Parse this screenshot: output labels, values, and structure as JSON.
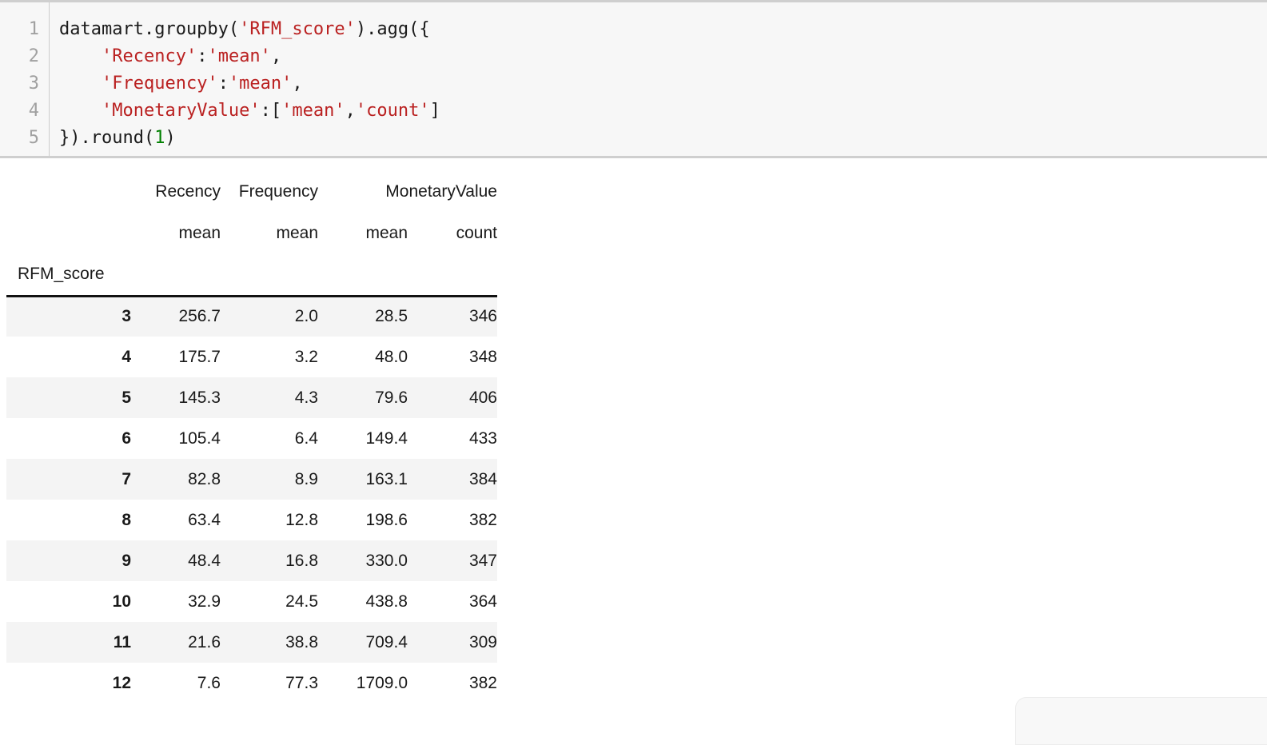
{
  "code_cell": {
    "line_numbers": [
      "1",
      "2",
      "3",
      "4",
      "5"
    ],
    "lines": [
      [
        {
          "t": "plain",
          "s": "datamart.groupby("
        },
        {
          "t": "str",
          "s": "'RFM_score'"
        },
        {
          "t": "plain",
          "s": ").agg({"
        }
      ],
      [
        {
          "t": "plain",
          "s": "    "
        },
        {
          "t": "str",
          "s": "'Recency'"
        },
        {
          "t": "plain",
          "s": ":"
        },
        {
          "t": "str",
          "s": "'mean'"
        },
        {
          "t": "plain",
          "s": ","
        }
      ],
      [
        {
          "t": "plain",
          "s": "    "
        },
        {
          "t": "str",
          "s": "'Frequency'"
        },
        {
          "t": "plain",
          "s": ":"
        },
        {
          "t": "str",
          "s": "'mean'"
        },
        {
          "t": "plain",
          "s": ","
        }
      ],
      [
        {
          "t": "plain",
          "s": "    "
        },
        {
          "t": "str",
          "s": "'MonetaryValue'"
        },
        {
          "t": "plain",
          "s": ":["
        },
        {
          "t": "str",
          "s": "'mean'"
        },
        {
          "t": "plain",
          "s": ","
        },
        {
          "t": "str",
          "s": "'count'"
        },
        {
          "t": "plain",
          "s": "]"
        }
      ],
      [
        {
          "t": "plain",
          "s": "}).round("
        },
        {
          "t": "num",
          "s": "1"
        },
        {
          "t": "plain",
          "s": ")"
        }
      ]
    ],
    "colors": {
      "string": "#ba2121",
      "number": "#008000",
      "plain": "#1a1a1a",
      "line_number": "#a0a0a0",
      "background": "#f7f7f7"
    }
  },
  "dataframe": {
    "index_name": "RFM_score",
    "top_headers": [
      "Recency",
      "Frequency",
      "MonetaryValue"
    ],
    "sub_headers": [
      "mean",
      "mean",
      "mean",
      "count"
    ],
    "columns": [
      {
        "top": "Recency",
        "sub": "mean"
      },
      {
        "top": "Frequency",
        "sub": "mean"
      },
      {
        "top": "MonetaryValue",
        "sub": "mean"
      },
      {
        "top": "MonetaryValue",
        "sub": "count"
      }
    ],
    "rows": [
      {
        "index": "3",
        "recency_mean": "256.7",
        "frequency_mean": "2.0",
        "monetary_mean": "28.5",
        "monetary_count": "346"
      },
      {
        "index": "4",
        "recency_mean": "175.7",
        "frequency_mean": "3.2",
        "monetary_mean": "48.0",
        "monetary_count": "348"
      },
      {
        "index": "5",
        "recency_mean": "145.3",
        "frequency_mean": "4.3",
        "monetary_mean": "79.6",
        "monetary_count": "406"
      },
      {
        "index": "6",
        "recency_mean": "105.4",
        "frequency_mean": "6.4",
        "monetary_mean": "149.4",
        "monetary_count": "433"
      },
      {
        "index": "7",
        "recency_mean": "82.8",
        "frequency_mean": "8.9",
        "monetary_mean": "163.1",
        "monetary_count": "384"
      },
      {
        "index": "8",
        "recency_mean": "63.4",
        "frequency_mean": "12.8",
        "monetary_mean": "198.6",
        "monetary_count": "382"
      },
      {
        "index": "9",
        "recency_mean": "48.4",
        "frequency_mean": "16.8",
        "monetary_mean": "330.0",
        "monetary_count": "347"
      },
      {
        "index": "10",
        "recency_mean": "32.9",
        "frequency_mean": "24.5",
        "monetary_mean": "438.8",
        "monetary_count": "364"
      },
      {
        "index": "11",
        "recency_mean": "21.6",
        "frequency_mean": "38.8",
        "monetary_mean": "709.4",
        "monetary_count": "309"
      },
      {
        "index": "12",
        "recency_mean": "7.6",
        "frequency_mean": "77.3",
        "monetary_mean": "1709.0",
        "monetary_count": "382"
      }
    ],
    "stripe_color": "#f4f4f4",
    "rule_color": "#111111"
  },
  "corner_panel": {
    "background": "#f8f8f8",
    "border_color": "#ececec"
  }
}
